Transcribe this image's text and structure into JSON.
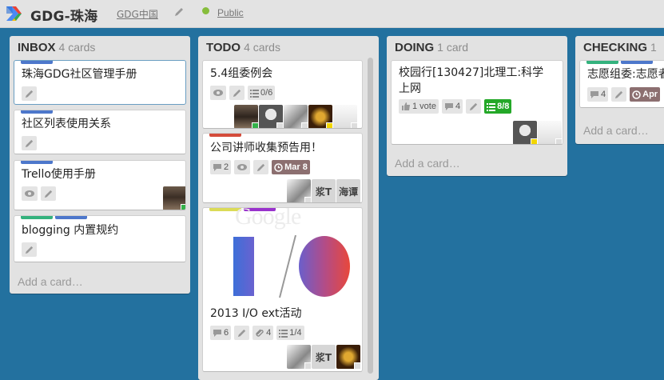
{
  "header": {
    "board_title": "GDG-珠海",
    "org_link": "GDG中国",
    "visibility": "Public",
    "colors": {
      "bar": "#e3e3e3",
      "public_dot": "#86bd3b",
      "board_bg": "#23719f"
    },
    "icons": [
      "gdg-logo-icon",
      "pencil-icon"
    ]
  },
  "lists": {
    "inbox": {
      "name": "INBOX",
      "count": "4 cards",
      "add_card": "Add a card…",
      "cards": [
        {
          "title": "珠海GDG社区管理手册",
          "labels": [
            "blue"
          ]
        },
        {
          "title": "社区列表使用关系",
          "labels": [
            "blue"
          ]
        },
        {
          "title": "Trello使用手册",
          "labels": [
            "blue"
          ]
        },
        {
          "title": "blogging 内置规约",
          "labels": [
            "green",
            "blue"
          ]
        }
      ]
    },
    "todo": {
      "name": "TODO",
      "count": "4 cards",
      "cards": [
        {
          "title": "5.4组委例会",
          "checklist": "0/6"
        },
        {
          "title": "公司讲师收集预告用！",
          "comments": "2",
          "due": "Mar 8",
          "members_text": [
            "浆T",
            "海谭"
          ]
        },
        {
          "title": "2013 I/O ext活动",
          "comments": "6",
          "attachments": "4",
          "checklist": "1/4",
          "members_text": [
            "浆T"
          ],
          "labels": [
            "yellow",
            "purple"
          ],
          "cover_text": "Google"
        }
      ]
    },
    "doing": {
      "name": "DOING",
      "count": "1 card",
      "add_card": "Add a card…",
      "cards": [
        {
          "title": "校园行[130427]北理工:科学上网",
          "votes": "1 vote",
          "comments": "4",
          "checklist": "8/8"
        }
      ]
    },
    "checking": {
      "name": "CHECKING",
      "count": "1",
      "add_card": "Add a card…",
      "cards": [
        {
          "title": "志愿组委:志愿者",
          "comments": "4",
          "due": "Apr"
        }
      ]
    }
  }
}
